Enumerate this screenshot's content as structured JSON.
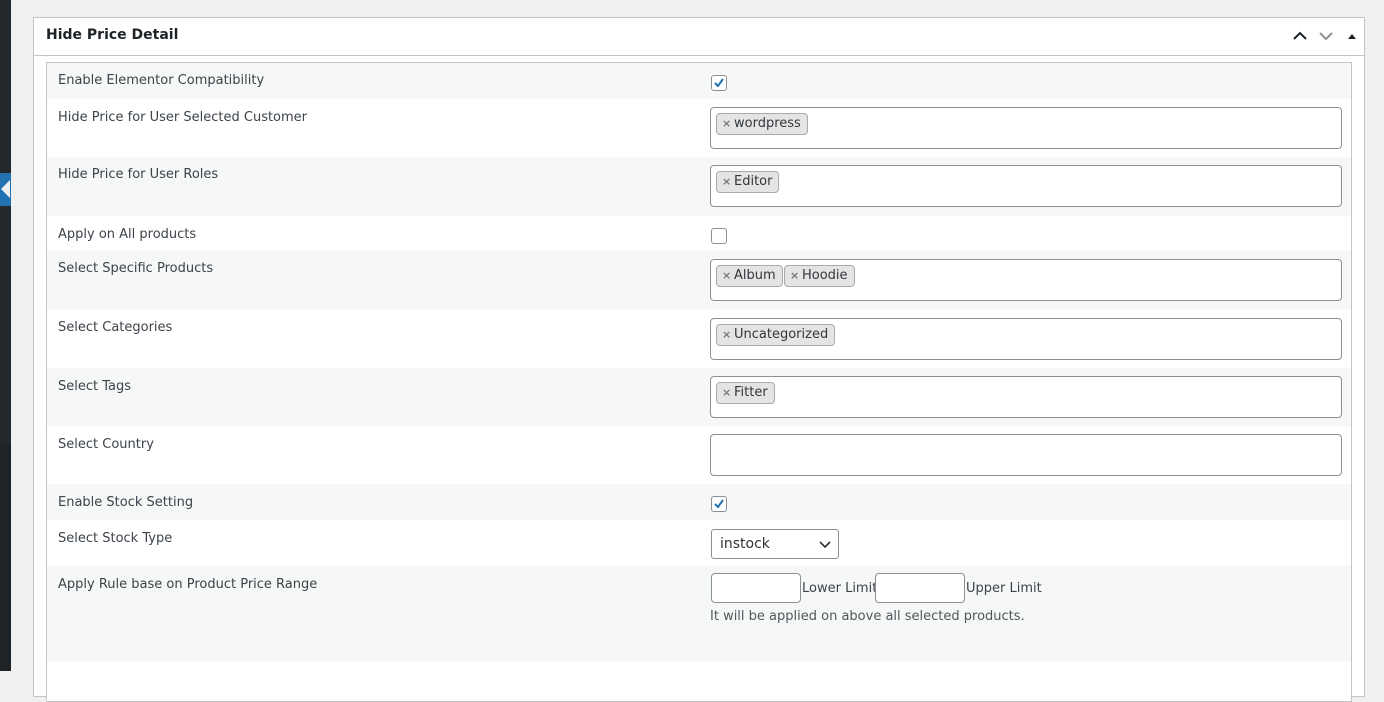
{
  "panel": {
    "title": "Hide Price Detail",
    "move_up_icon": "chevron-up-icon",
    "move_down_icon": "chevron-down-icon",
    "toggle_icon": "triangle-up-icon"
  },
  "fields": {
    "elementor": {
      "label": "Enable Elementor Compatibility",
      "checked": true
    },
    "customers": {
      "label": "Hide Price for User Selected Customer",
      "tags": [
        "wordpress"
      ]
    },
    "roles": {
      "label": "Hide Price for User Roles",
      "tags": [
        "Editor"
      ]
    },
    "all_products": {
      "label": "Apply on All products",
      "checked": false
    },
    "products": {
      "label": "Select Specific Products",
      "tags": [
        "Album",
        "Hoodie"
      ]
    },
    "categories": {
      "label": "Select Categories",
      "tags": [
        "Uncategorized"
      ]
    },
    "tags": {
      "label": "Select Tags",
      "tags": [
        "Fitter"
      ]
    },
    "country": {
      "label": "Select Country",
      "tags": []
    },
    "stock_setting": {
      "label": "Enable Stock Setting",
      "checked": true
    },
    "stock_type": {
      "label": "Select Stock Type",
      "value": "instock"
    },
    "price_range": {
      "label": "Apply Rule base on Product Price Range",
      "lower_label": "Lower Limit",
      "upper_label": "Upper Limit",
      "lower_value": "",
      "upper_value": "",
      "hint": "It will be applied on above all selected products."
    }
  },
  "tag_remove_glyph": "×",
  "colors": {
    "accent": "#2271b1",
    "border": "#8c8f94",
    "alt_row": "#f6f7f7"
  }
}
